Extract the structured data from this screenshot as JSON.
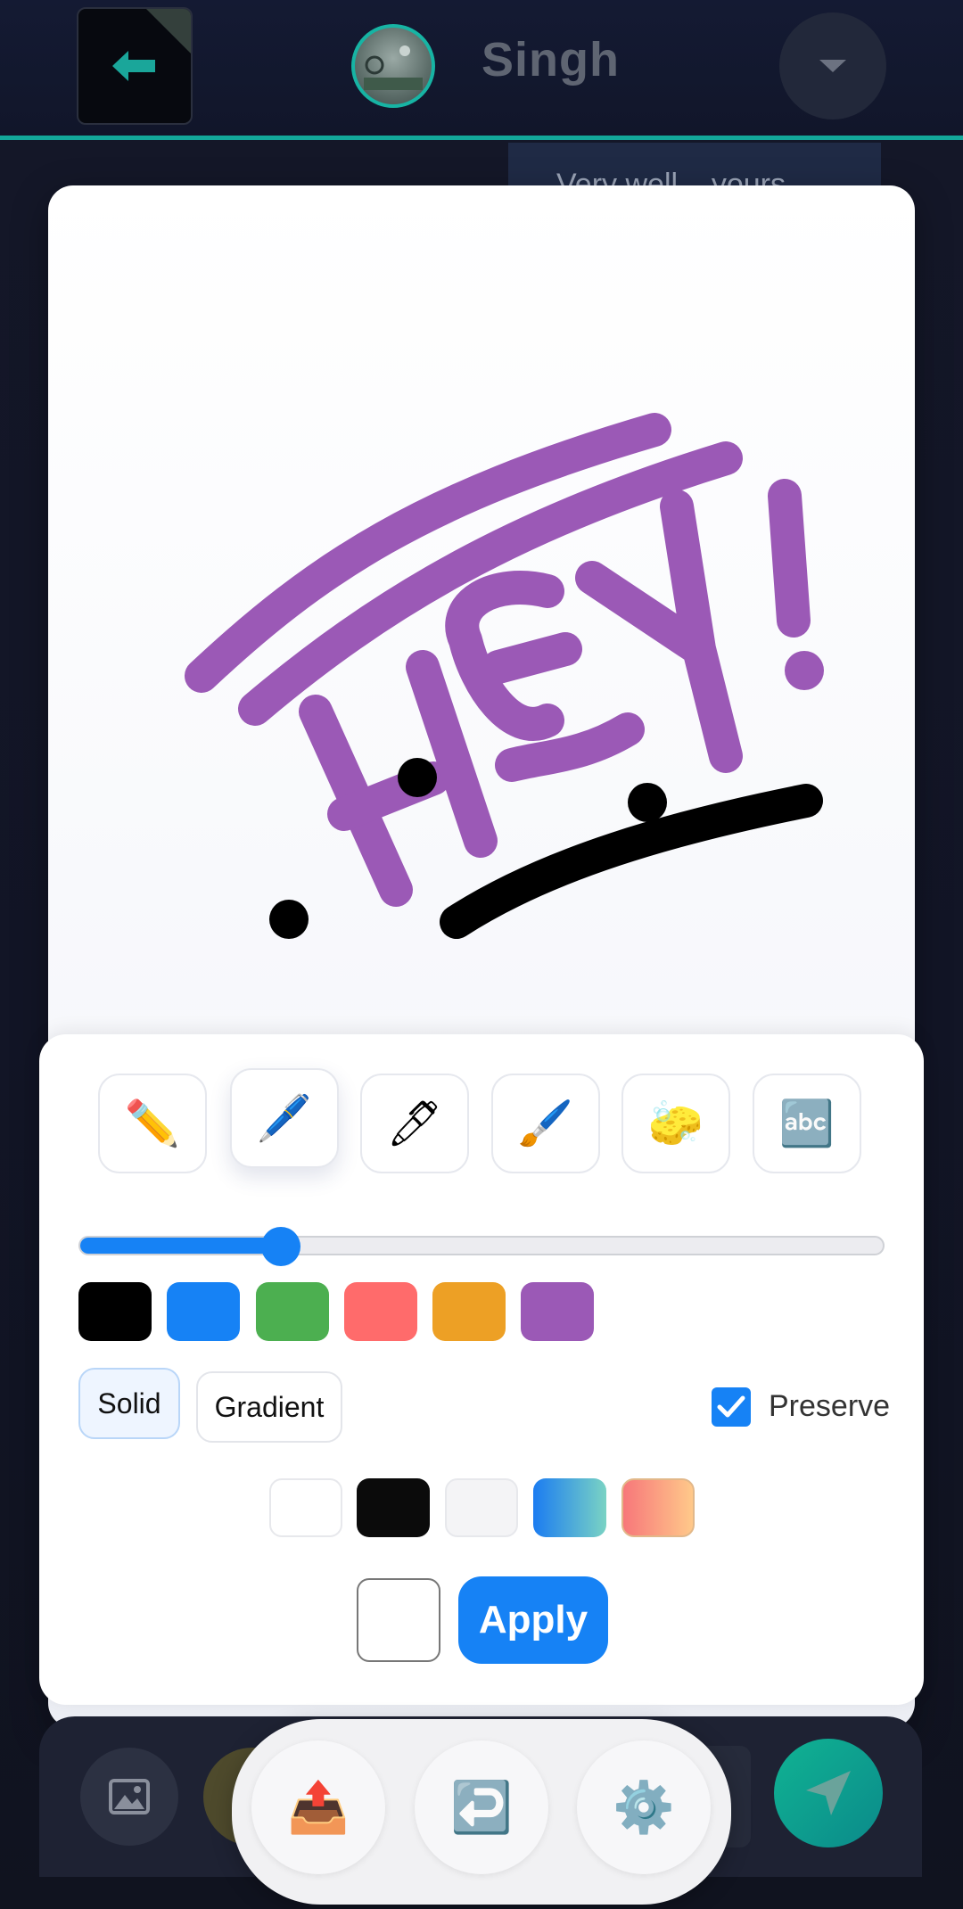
{
  "header": {
    "contact_name": "Singh",
    "back_icon": "arrow-left-icon",
    "menu_icon": "chevron-down-icon"
  },
  "chat": {
    "partial_message": "Very well... yours"
  },
  "canvas": {
    "drawing_text": "HEY!",
    "stroke_colors": [
      "#9b59b6",
      "#000000"
    ]
  },
  "tools": [
    {
      "name": "pencil",
      "glyph": "✏️"
    },
    {
      "name": "marker",
      "glyph": "🖊️"
    },
    {
      "name": "pen",
      "glyph": "🖊"
    },
    {
      "name": "brush",
      "glyph": "🖌️"
    },
    {
      "name": "sponge",
      "glyph": "🧽"
    },
    {
      "name": "text",
      "glyph": "🔤"
    }
  ],
  "brush_size": {
    "value_fraction": 0.25
  },
  "colors": [
    "#000000",
    "#1682f5",
    "#4caf50",
    "#ff6b6b",
    "#eda025",
    "#9b59b6"
  ],
  "modes": {
    "solid_label": "Solid",
    "gradient_label": "Gradient",
    "preserve_label": "Preserve",
    "preserve_checked": true
  },
  "backgrounds": [
    {
      "name": "white",
      "fill": "#ffffff"
    },
    {
      "name": "black",
      "fill": "#0b0b0b"
    },
    {
      "name": "light-gray",
      "fill": "#f4f4f6"
    },
    {
      "name": "blue-teal-gradient",
      "fill": "linear-gradient(90deg,#1b7cf1,#7ad3c4)"
    },
    {
      "name": "coral-peach-gradient",
      "fill": "linear-gradient(90deg,#f7777a,#ffc98a)"
    }
  ],
  "apply_label": "Apply",
  "bottom_actions": [
    {
      "name": "upload",
      "glyph": "📤"
    },
    {
      "name": "undo",
      "glyph": "↩️"
    },
    {
      "name": "settings",
      "glyph": "⚙️"
    }
  ]
}
